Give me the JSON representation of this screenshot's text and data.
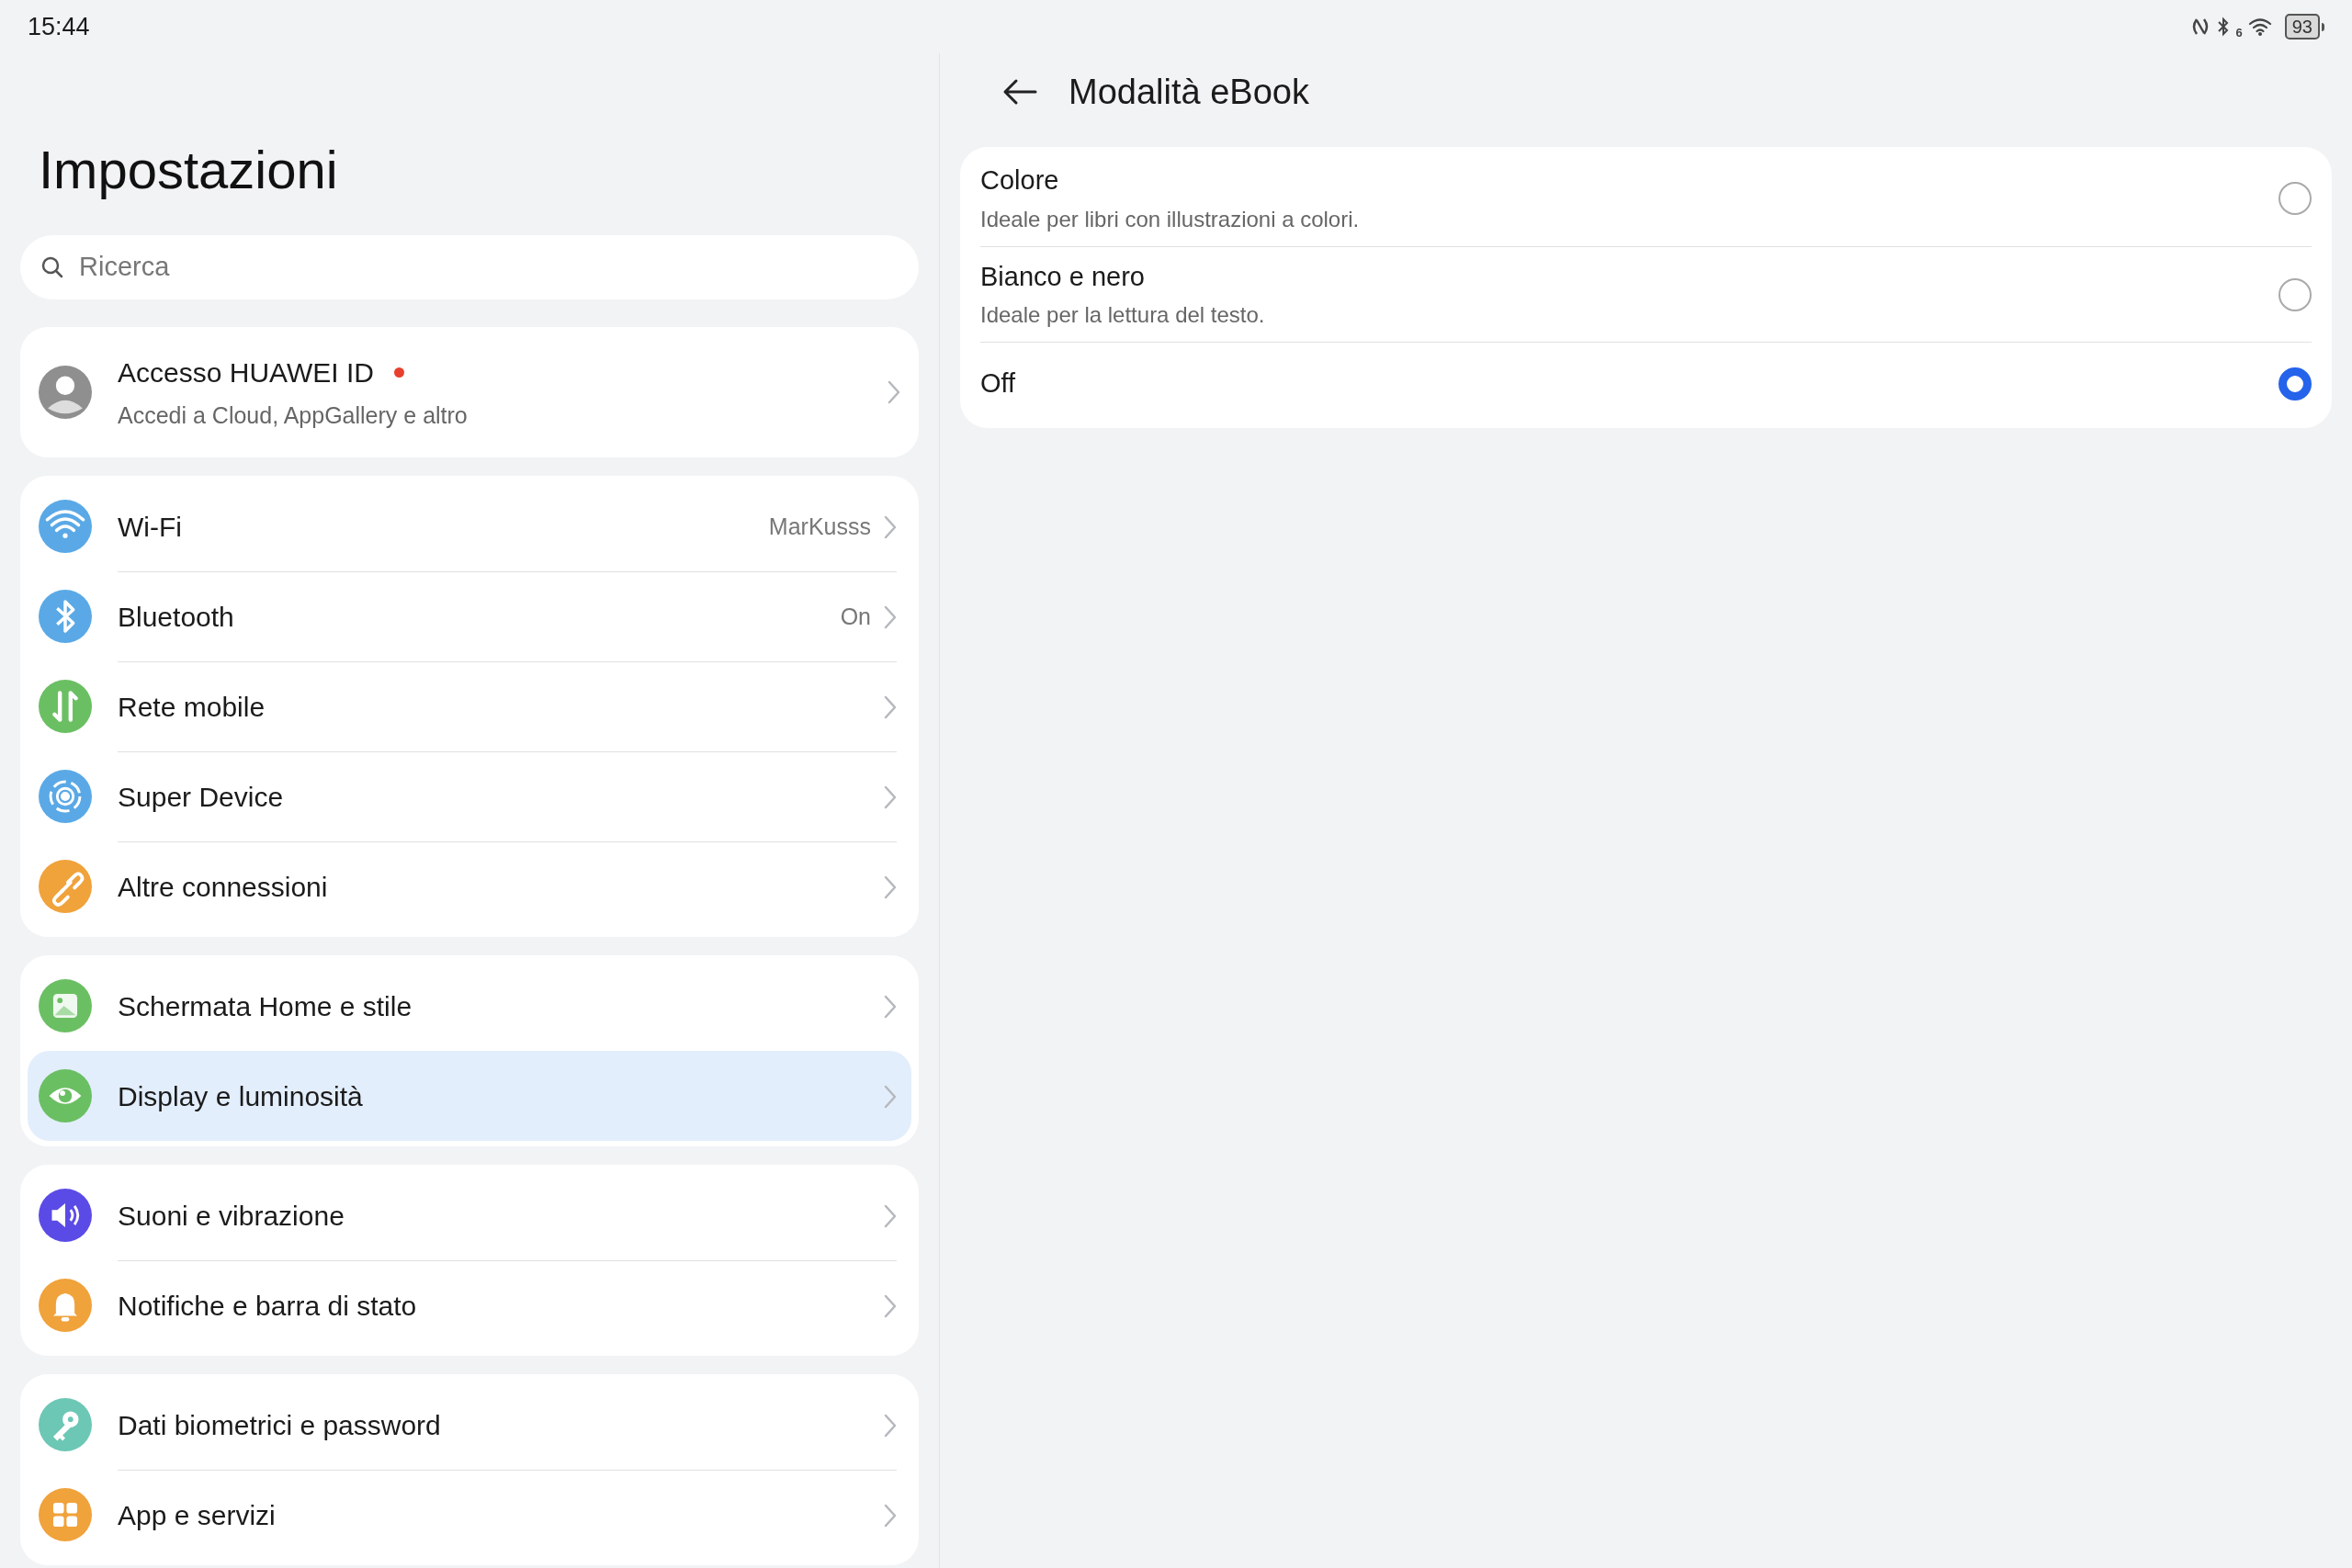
{
  "status_bar": {
    "time": "15:44",
    "wifi_label": "6",
    "battery": "93"
  },
  "settings": {
    "title": "Impostazioni",
    "search": {
      "placeholder": "Ricerca"
    },
    "account": {
      "title": "Accesso HUAWEI ID",
      "subtitle": "Accedi a Cloud, AppGallery e altro",
      "notification_dot": true
    },
    "groups": [
      {
        "items": [
          {
            "label": "Wi-Fi",
            "value": "MarKusss",
            "color": "#5aa9e6",
            "selected": false
          },
          {
            "label": "Bluetooth",
            "value": "On",
            "color": "#5aa9e6",
            "selected": false
          },
          {
            "label": "Rete mobile",
            "color": "#6bbf63",
            "selected": false
          },
          {
            "label": "Super Device",
            "color": "#5aa9e6",
            "selected": false
          },
          {
            "label": "Altre connessioni",
            "color": "#f0a23b",
            "selected": false
          }
        ]
      },
      {
        "items": [
          {
            "label": "Schermata Home e stile",
            "color": "#6bbf63",
            "selected": false
          },
          {
            "label": "Display e luminosità",
            "color": "#6bbf63",
            "selected": true
          }
        ]
      },
      {
        "items": [
          {
            "label": "Suoni e vibrazione",
            "color": "#5b4be6",
            "selected": false
          },
          {
            "label": "Notifiche e barra di stato",
            "color": "#f0a23b",
            "selected": false
          }
        ]
      },
      {
        "items": [
          {
            "label": "Dati biometrici e password",
            "color": "#6cc7b5",
            "selected": false
          },
          {
            "label": "App e servizi",
            "color": "#f0a23b",
            "selected": false
          }
        ]
      }
    ]
  },
  "detail": {
    "title": "Modalità eBook",
    "options": [
      {
        "label": "Colore",
        "description": "Ideale per libri con illustrazioni a colori.",
        "selected": false
      },
      {
        "label": "Bianco e nero",
        "description": "Ideale per la lettura del testo.",
        "selected": false
      },
      {
        "label": "Off",
        "selected": true
      }
    ]
  }
}
